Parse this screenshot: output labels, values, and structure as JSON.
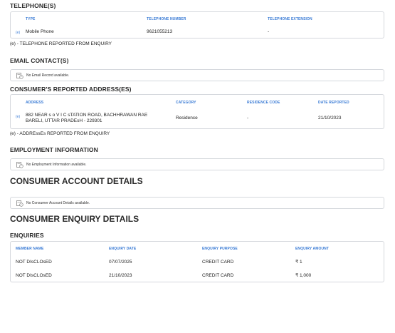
{
  "telephones": {
    "title": "TELEPHONE(S)",
    "headers": [
      "TYPE",
      "TELEPHONE NUMBER",
      "TELEPHONE EXTENSION"
    ],
    "rows": [
      {
        "tag": "(e)",
        "type": "Mobile Phone",
        "number": "9621055213",
        "extension": "-"
      }
    ],
    "note": "(e) - TELEPHONE REPORTED FROM ENQUIRY"
  },
  "email": {
    "title": "EMAIL CONTACT(S)",
    "empty_text": "No Email Record available."
  },
  "address": {
    "title": "CONSUMER'S REPORTED ADDRESS(ES)",
    "headers": [
      "ADDRESS",
      "CATEGORY",
      "RESIDENCE CODE",
      "DATE REPORTED"
    ],
    "rows": [
      {
        "tag": "(e)",
        "address_line1": "882 NEAR s o V I C sTATION ROAD, BACHHRAWAN RAE",
        "address_line2": "BARELI, UTTAR PRADEsH - 229301",
        "category": "Residence",
        "residence_code": "-",
        "date_reported": "21/10/2023"
      }
    ],
    "note": "(e) - ADDREssEs REPORTED FROM ENQUIRY"
  },
  "employment": {
    "title": "EMPLOYMENT INFORMATION",
    "empty_text": "No Employment Information available."
  },
  "accounts": {
    "title": "CONSUMER ACCOUNT DETAILS",
    "empty_text": "No Consumer Account Details available."
  },
  "enquiry_details": {
    "title": "CONSUMER ENQUIRY DETAILS"
  },
  "enquiries": {
    "title": "ENQUIRIES",
    "headers": [
      "MEMBER NAME",
      "ENQUIRY DATE",
      "ENQUIRY PURPOSE",
      "ENQUIRY AMOUNT"
    ],
    "rows": [
      {
        "member": "NOT DIsCLOsED",
        "date": "07/07/2025",
        "purpose": "CREDIT CARD",
        "amount": "₹ 1"
      },
      {
        "member": "NOT DIsCLOsED",
        "date": "21/10/2023",
        "purpose": "CREDIT CARD",
        "amount": "₹ 1,000"
      }
    ]
  },
  "colors": {
    "header_blue": "#3a7bd5",
    "border": "#d5d8dd",
    "text": "#222222"
  },
  "icons": {
    "empty_state": "document-clock-icon"
  }
}
